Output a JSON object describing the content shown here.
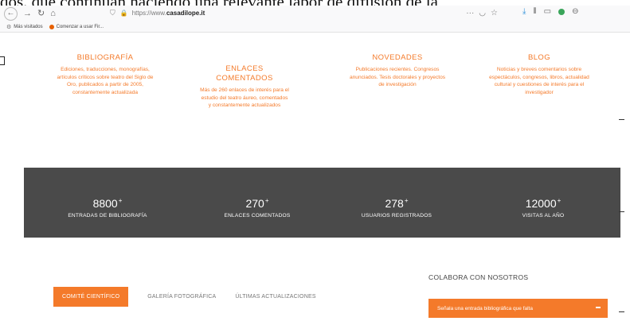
{
  "document_text": "dos. que continúan haciendo una relevante labor de difusión de la",
  "browser": {
    "back_icon": "back-arrow-icon",
    "url_prefix": "https://www.",
    "url_domain": "casadilope.it",
    "bookmarks": [
      {
        "icon": "gear-icon",
        "label": "Más visitados"
      },
      {
        "icon": "firefox-icon",
        "label": "Comenzar a usar Fir..."
      }
    ]
  },
  "features": [
    {
      "title": "BIBLIOGRAFÍA",
      "desc": "Ediciones, traducciones, monografías, artículos críticos sobre teatro del Siglo de Oro, publicados a partir de 2005, constantemente actualizada"
    },
    {
      "title": "ENLACES COMENTADOS",
      "desc": "Más de 260 enlaces de interés para el estudio del teatro áureo, comentados y constantemente actualizados"
    },
    {
      "title": "NOVEDADES",
      "desc": "Publicaciones recientes. Congresos anunciados. Tesis doctorales y proyectos de investigación"
    },
    {
      "title": "BLOG",
      "desc": "Noticias y breves comentarios sobre espectáculos, congresos, libros, actualidad cultural y cuestiones de interés para el investigador"
    }
  ],
  "stats": [
    {
      "value": "8800",
      "suffix": "+",
      "label": "ENTRADAS DE BIBLIOGRAFÍA"
    },
    {
      "value": "270",
      "suffix": "+",
      "label": "ENLACES COMENTADOS"
    },
    {
      "value": "278",
      "suffix": "+",
      "label": "USUARIOS REGISTRADOS"
    },
    {
      "value": "12000",
      "suffix": "+",
      "label": "VISITAS AL AÑO"
    }
  ],
  "tabs": {
    "active": "COMITÉ CIENTÍFICO",
    "others": [
      "GALERÍA FOTOGRÁFICA",
      "ÚLTIMAS ACTUALIZACIONES"
    ]
  },
  "collab": {
    "title": "COLABORA CON NOSOTROS",
    "button": "Señala una entrada bibliográfica que falta"
  },
  "colors": {
    "accent": "#f47a2a",
    "band": "#4a4a4a"
  }
}
